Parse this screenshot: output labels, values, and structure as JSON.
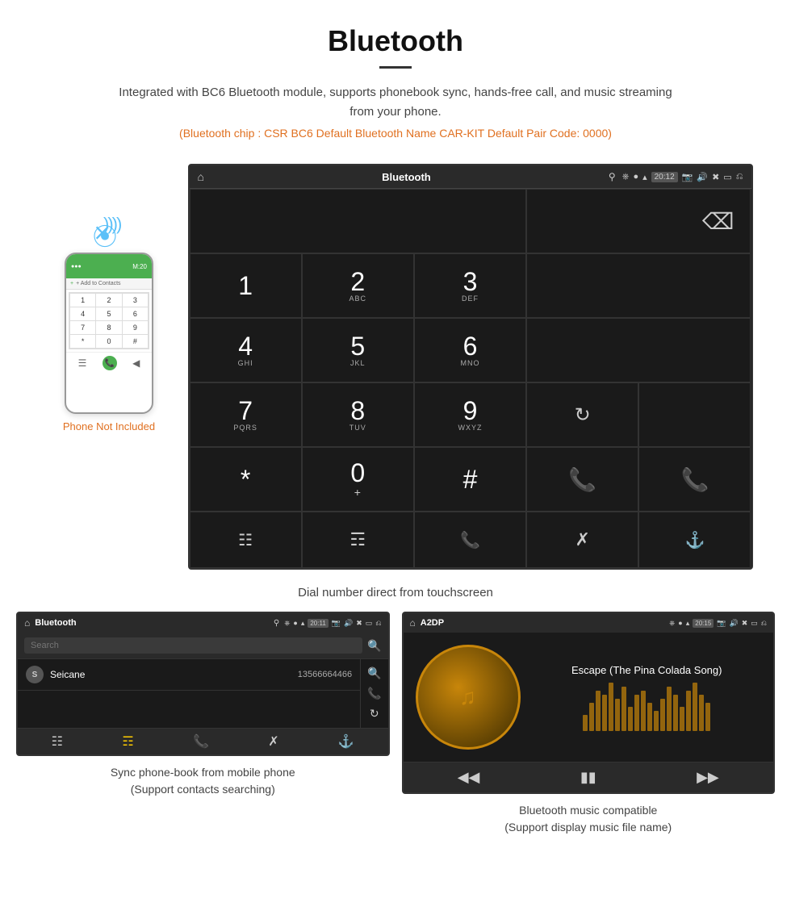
{
  "header": {
    "title": "Bluetooth",
    "description": "Integrated with BC6 Bluetooth module, supports phonebook sync, hands-free call, and music streaming from your phone.",
    "specs": "(Bluetooth chip : CSR BC6    Default Bluetooth Name CAR-KIT    Default Pair Code: 0000)"
  },
  "dial_screen": {
    "title": "Bluetooth",
    "time": "20:12",
    "keys": [
      {
        "num": "1",
        "sub": "⌂⌂"
      },
      {
        "num": "2",
        "sub": "ABC"
      },
      {
        "num": "3",
        "sub": "DEF"
      },
      {
        "num": "4",
        "sub": "GHI"
      },
      {
        "num": "5",
        "sub": "JKL"
      },
      {
        "num": "6",
        "sub": "MNO"
      },
      {
        "num": "7",
        "sub": "PQRS"
      },
      {
        "num": "8",
        "sub": "TUV"
      },
      {
        "num": "9",
        "sub": "WXYZ"
      },
      {
        "num": "*",
        "sub": ""
      },
      {
        "num": "0",
        "sub": "+"
      },
      {
        "num": "#",
        "sub": ""
      }
    ],
    "caption": "Dial number direct from touchscreen"
  },
  "phone": {
    "not_included_label": "Phone Not Included",
    "contact_label": "+ Add to Contacts",
    "time": "M:20",
    "keys": [
      "1",
      "2",
      "3",
      "4",
      "5",
      "6",
      "7",
      "8",
      "9",
      "*",
      "0",
      "#"
    ]
  },
  "phonebook_screen": {
    "title": "Bluetooth",
    "time": "20:11",
    "search_placeholder": "Search",
    "contact_name": "Seicane",
    "contact_phone": "13566664466",
    "contact_initial": "S",
    "caption_line1": "Sync phone-book from mobile phone",
    "caption_line2": "(Support contacts searching)"
  },
  "music_screen": {
    "title": "A2DP",
    "time": "20:15",
    "song_title": "Escape (The Pina Colada Song)",
    "eq_bars": [
      20,
      35,
      50,
      45,
      60,
      40,
      55,
      30,
      45,
      50,
      35,
      25,
      40,
      55,
      45,
      30,
      50,
      60,
      45,
      35
    ],
    "caption_line1": "Bluetooth music compatible",
    "caption_line2": "(Support display music file name)"
  },
  "colors": {
    "accent_orange": "#e07020",
    "accent_blue": "#5bc0f8",
    "accent_green": "#4caf50",
    "accent_red": "#f44336",
    "accent_gold": "#c8860a",
    "screen_bg": "#1a1a1a",
    "screen_bar": "#2a2a2a"
  }
}
